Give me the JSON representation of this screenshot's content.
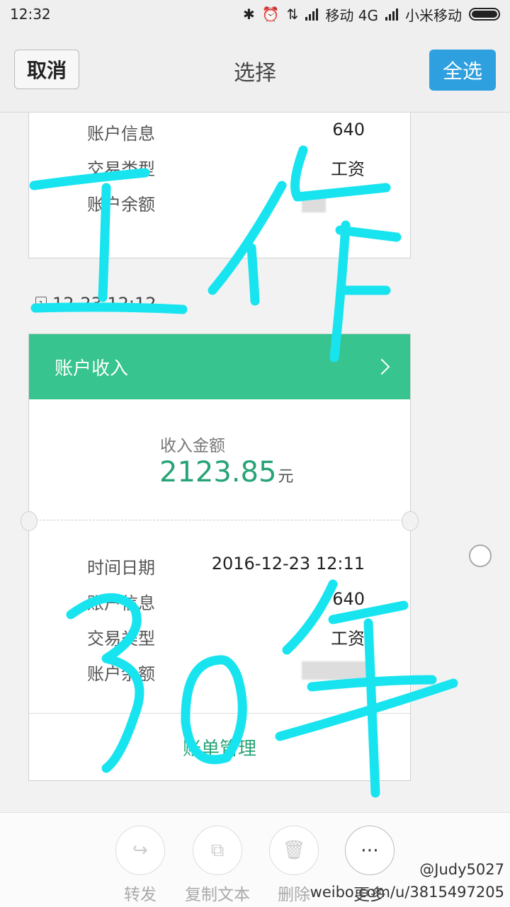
{
  "status_bar": {
    "time": "12:32",
    "carrier1": "移动 4G",
    "carrier2": "小米移动"
  },
  "nav": {
    "cancel_label": "取消",
    "title": "选择",
    "select_all_label": "全选"
  },
  "card_top": {
    "rows": [
      {
        "label": "账户信息",
        "value": "640"
      },
      {
        "label": "交易类型",
        "value": "工资"
      },
      {
        "label": "账户余额",
        "value": ""
      }
    ]
  },
  "message": {
    "timestamp": "12-23 12:12",
    "header_title": "账户收入",
    "amount_label": "收入金额",
    "amount": "2123.85",
    "amount_unit": "元",
    "rows": [
      {
        "label": "时间日期",
        "value": "2016-12-23 12:11"
      },
      {
        "label": "账户信息",
        "value": "640"
      },
      {
        "label": "交易类型",
        "value": "工资"
      },
      {
        "label": "账户余额",
        "value": ""
      }
    ],
    "footer_link": "账单管理"
  },
  "toolbar": {
    "items": [
      {
        "label": "转发",
        "icon": "forward-icon"
      },
      {
        "label": "复制文本",
        "icon": "copy-icon"
      },
      {
        "label": "删除",
        "icon": "trash-icon"
      },
      {
        "label": "更多",
        "icon": "more-icon"
      }
    ]
  },
  "watermark": {
    "handle": "@Judy5027",
    "url": "weibo.com/u/3815497205"
  },
  "handwriting": {
    "text": "工作30年",
    "color": "#18e4f0"
  }
}
